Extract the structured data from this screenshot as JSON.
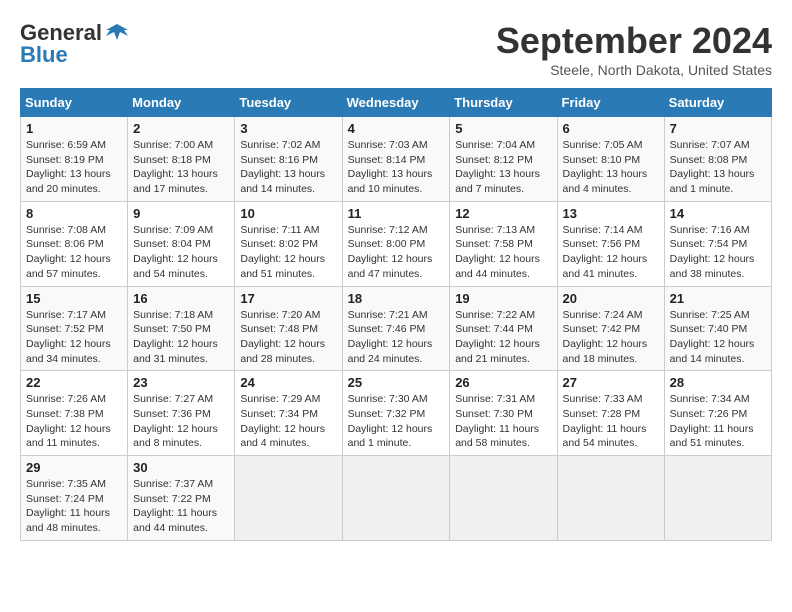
{
  "header": {
    "logo_general": "General",
    "logo_blue": "Blue",
    "month_title": "September 2024",
    "location": "Steele, North Dakota, United States"
  },
  "days_of_week": [
    "Sunday",
    "Monday",
    "Tuesday",
    "Wednesday",
    "Thursday",
    "Friday",
    "Saturday"
  ],
  "weeks": [
    [
      {
        "day": "1",
        "sunrise": "Sunrise: 6:59 AM",
        "sunset": "Sunset: 8:19 PM",
        "daylight": "Daylight: 13 hours and 20 minutes."
      },
      {
        "day": "2",
        "sunrise": "Sunrise: 7:00 AM",
        "sunset": "Sunset: 8:18 PM",
        "daylight": "Daylight: 13 hours and 17 minutes."
      },
      {
        "day": "3",
        "sunrise": "Sunrise: 7:02 AM",
        "sunset": "Sunset: 8:16 PM",
        "daylight": "Daylight: 13 hours and 14 minutes."
      },
      {
        "day": "4",
        "sunrise": "Sunrise: 7:03 AM",
        "sunset": "Sunset: 8:14 PM",
        "daylight": "Daylight: 13 hours and 10 minutes."
      },
      {
        "day": "5",
        "sunrise": "Sunrise: 7:04 AM",
        "sunset": "Sunset: 8:12 PM",
        "daylight": "Daylight: 13 hours and 7 minutes."
      },
      {
        "day": "6",
        "sunrise": "Sunrise: 7:05 AM",
        "sunset": "Sunset: 8:10 PM",
        "daylight": "Daylight: 13 hours and 4 minutes."
      },
      {
        "day": "7",
        "sunrise": "Sunrise: 7:07 AM",
        "sunset": "Sunset: 8:08 PM",
        "daylight": "Daylight: 13 hours and 1 minute."
      }
    ],
    [
      {
        "day": "8",
        "sunrise": "Sunrise: 7:08 AM",
        "sunset": "Sunset: 8:06 PM",
        "daylight": "Daylight: 12 hours and 57 minutes."
      },
      {
        "day": "9",
        "sunrise": "Sunrise: 7:09 AM",
        "sunset": "Sunset: 8:04 PM",
        "daylight": "Daylight: 12 hours and 54 minutes."
      },
      {
        "day": "10",
        "sunrise": "Sunrise: 7:11 AM",
        "sunset": "Sunset: 8:02 PM",
        "daylight": "Daylight: 12 hours and 51 minutes."
      },
      {
        "day": "11",
        "sunrise": "Sunrise: 7:12 AM",
        "sunset": "Sunset: 8:00 PM",
        "daylight": "Daylight: 12 hours and 47 minutes."
      },
      {
        "day": "12",
        "sunrise": "Sunrise: 7:13 AM",
        "sunset": "Sunset: 7:58 PM",
        "daylight": "Daylight: 12 hours and 44 minutes."
      },
      {
        "day": "13",
        "sunrise": "Sunrise: 7:14 AM",
        "sunset": "Sunset: 7:56 PM",
        "daylight": "Daylight: 12 hours and 41 minutes."
      },
      {
        "day": "14",
        "sunrise": "Sunrise: 7:16 AM",
        "sunset": "Sunset: 7:54 PM",
        "daylight": "Daylight: 12 hours and 38 minutes."
      }
    ],
    [
      {
        "day": "15",
        "sunrise": "Sunrise: 7:17 AM",
        "sunset": "Sunset: 7:52 PM",
        "daylight": "Daylight: 12 hours and 34 minutes."
      },
      {
        "day": "16",
        "sunrise": "Sunrise: 7:18 AM",
        "sunset": "Sunset: 7:50 PM",
        "daylight": "Daylight: 12 hours and 31 minutes."
      },
      {
        "day": "17",
        "sunrise": "Sunrise: 7:20 AM",
        "sunset": "Sunset: 7:48 PM",
        "daylight": "Daylight: 12 hours and 28 minutes."
      },
      {
        "day": "18",
        "sunrise": "Sunrise: 7:21 AM",
        "sunset": "Sunset: 7:46 PM",
        "daylight": "Daylight: 12 hours and 24 minutes."
      },
      {
        "day": "19",
        "sunrise": "Sunrise: 7:22 AM",
        "sunset": "Sunset: 7:44 PM",
        "daylight": "Daylight: 12 hours and 21 minutes."
      },
      {
        "day": "20",
        "sunrise": "Sunrise: 7:24 AM",
        "sunset": "Sunset: 7:42 PM",
        "daylight": "Daylight: 12 hours and 18 minutes."
      },
      {
        "day": "21",
        "sunrise": "Sunrise: 7:25 AM",
        "sunset": "Sunset: 7:40 PM",
        "daylight": "Daylight: 12 hours and 14 minutes."
      }
    ],
    [
      {
        "day": "22",
        "sunrise": "Sunrise: 7:26 AM",
        "sunset": "Sunset: 7:38 PM",
        "daylight": "Daylight: 12 hours and 11 minutes."
      },
      {
        "day": "23",
        "sunrise": "Sunrise: 7:27 AM",
        "sunset": "Sunset: 7:36 PM",
        "daylight": "Daylight: 12 hours and 8 minutes."
      },
      {
        "day": "24",
        "sunrise": "Sunrise: 7:29 AM",
        "sunset": "Sunset: 7:34 PM",
        "daylight": "Daylight: 12 hours and 4 minutes."
      },
      {
        "day": "25",
        "sunrise": "Sunrise: 7:30 AM",
        "sunset": "Sunset: 7:32 PM",
        "daylight": "Daylight: 12 hours and 1 minute."
      },
      {
        "day": "26",
        "sunrise": "Sunrise: 7:31 AM",
        "sunset": "Sunset: 7:30 PM",
        "daylight": "Daylight: 11 hours and 58 minutes."
      },
      {
        "day": "27",
        "sunrise": "Sunrise: 7:33 AM",
        "sunset": "Sunset: 7:28 PM",
        "daylight": "Daylight: 11 hours and 54 minutes."
      },
      {
        "day": "28",
        "sunrise": "Sunrise: 7:34 AM",
        "sunset": "Sunset: 7:26 PM",
        "daylight": "Daylight: 11 hours and 51 minutes."
      }
    ],
    [
      {
        "day": "29",
        "sunrise": "Sunrise: 7:35 AM",
        "sunset": "Sunset: 7:24 PM",
        "daylight": "Daylight: 11 hours and 48 minutes."
      },
      {
        "day": "30",
        "sunrise": "Sunrise: 7:37 AM",
        "sunset": "Sunset: 7:22 PM",
        "daylight": "Daylight: 11 hours and 44 minutes."
      },
      null,
      null,
      null,
      null,
      null
    ]
  ]
}
